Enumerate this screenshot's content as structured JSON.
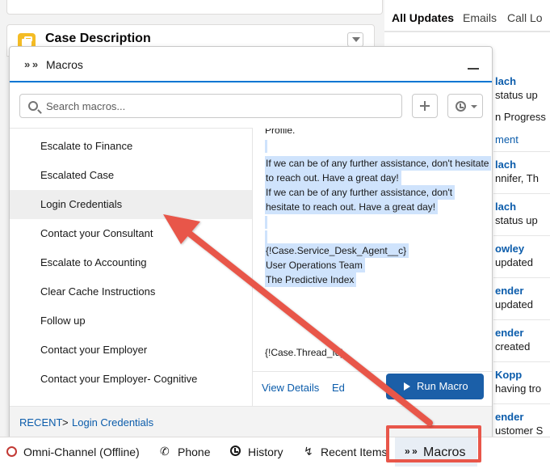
{
  "feed": {
    "tabs": [
      "All Updates",
      "Emails",
      "Call Lo"
    ],
    "lines": [
      {
        "text": "lach",
        "kind": "name"
      },
      {
        "text": "status up",
        "kind": "text"
      },
      {
        "text": "n Progress",
        "kind": "text"
      },
      {
        "text": "ment",
        "kind": "link"
      },
      {
        "text": "lach",
        "kind": "name"
      },
      {
        "text": "nnifer, Th",
        "kind": "text"
      },
      {
        "text": "lach",
        "kind": "name"
      },
      {
        "text": "status up",
        "kind": "text"
      },
      {
        "text": "owley",
        "kind": "name"
      },
      {
        "text": "updated",
        "kind": "text"
      },
      {
        "text": "ender",
        "kind": "name"
      },
      {
        "text": "updated",
        "kind": "text"
      },
      {
        "text": "ender",
        "kind": "name"
      },
      {
        "text": "created",
        "kind": "text"
      },
      {
        "text": "Kopp",
        "kind": "name"
      },
      {
        "text": "having tro",
        "kind": "text"
      },
      {
        "text": "ender",
        "kind": "name"
      },
      {
        "text": "ustomer S",
        "kind": "text"
      }
    ]
  },
  "case_card": {
    "title": "Case Description"
  },
  "macros_panel": {
    "title": "Macros",
    "search_placeholder": "Search macros...",
    "items": [
      "Escalate to Finance",
      "Escalated Case",
      "Login Credentials",
      "Contact your Consultant",
      "Escalate to Accounting",
      "Clear Cache Instructions",
      "Follow up",
      "Contact your Employer",
      "Contact your Employer- Cognitive"
    ],
    "selected_index": 2,
    "preview": {
      "top_partial": "Profile.",
      "lines": [
        "If we can be of any further assistance, don't hesitate",
        "to reach out. Have a great day!",
        "If we can be of any further assistance, don't",
        "hesitate to reach out. Have a great day!",
        "{!Case.Service_Desk_Agent__c}",
        "User Operations Team",
        "The Predictive Index",
        "{!Case.Thread_Id}"
      ]
    },
    "view_details": "View Details",
    "edit_partial": "Ed",
    "run_macro": "Run Macro",
    "recent": {
      "label": "RECENT",
      "separator": ">",
      "item": "Login Credentials"
    }
  },
  "utility_bar": {
    "omni": "Omni-Channel (Offline)",
    "phone": "Phone",
    "history": "History",
    "recent_items": "Recent Items",
    "macros": "Macros"
  },
  "colors": {
    "brand_blue": "#0176d3",
    "button_blue": "#1b5fa8",
    "annotation_red": "#e8564a",
    "highlight": "#cfe3fc"
  }
}
